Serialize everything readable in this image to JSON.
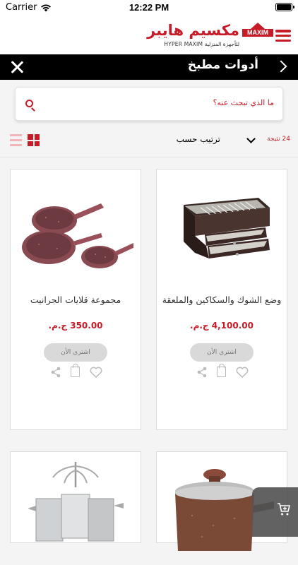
{
  "status_bar": {
    "carrier": "Carrier",
    "time": "12:22 PM"
  },
  "header": {
    "brand_arabic": "مكسيم هايبر",
    "brand_sub": "HYPER MAXIM للأجهزة المنزلية",
    "logo_text": "MAXIM"
  },
  "title_bar": {
    "title": "أدوات مطبخ"
  },
  "search": {
    "placeholder": "ما الذي تبحث عنه؟"
  },
  "toolbar": {
    "results": "24 نتيجة",
    "sort_label": "ترتيب حسب"
  },
  "products": [
    {
      "name": "وضع الشوك والسكاكين والملعقة",
      "price": "4,100.00 ج.م.",
      "buy_label": "اشتري الأن",
      "image": "cutlery-box"
    },
    {
      "name": "مجموعة قلايات الجرانيت",
      "price": "350.00 ج.م.",
      "buy_label": "اشتري الأن",
      "image": "granite-pans"
    },
    {
      "name": "",
      "price": "",
      "buy_label": "",
      "image": "granite-pot"
    },
    {
      "name": "",
      "price": "",
      "buy_label": "",
      "image": "coffee-pots-rack"
    }
  ],
  "colors": {
    "accent": "#c61c28",
    "title_bar": "#000000",
    "fab": "#555555"
  }
}
